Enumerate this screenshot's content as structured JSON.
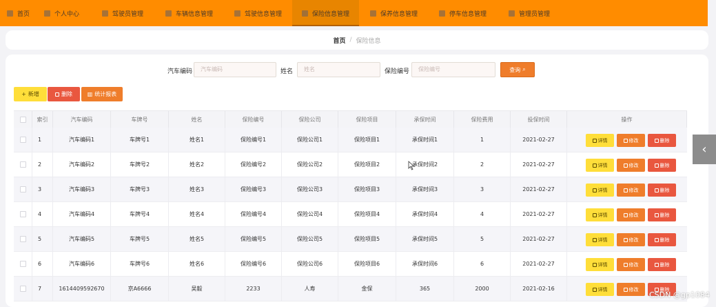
{
  "nav": {
    "items": [
      {
        "label": "首页",
        "icon": "home-icon"
      },
      {
        "label": "个人中心",
        "icon": "user-icon"
      },
      {
        "label": "驾驶员管理",
        "icon": "grid-icon"
      },
      {
        "label": "车辆信息管理",
        "icon": "user-icon"
      },
      {
        "label": "驾驶信息管理",
        "icon": "grid-icon"
      },
      {
        "label": "保险信息管理",
        "icon": "grid-icon"
      },
      {
        "label": "保养信息管理",
        "icon": "grid-icon"
      },
      {
        "label": "停车信息管理",
        "icon": "grid-icon"
      },
      {
        "label": "管理员管理",
        "icon": "user-icon"
      }
    ],
    "active_index": 5,
    "bg_color": "#ff8c00"
  },
  "breadcrumb": {
    "home": "首页",
    "separator": "/",
    "current": "保险信息"
  },
  "search": {
    "fields": [
      {
        "label": "汽车编码",
        "placeholder": "汽车编码"
      },
      {
        "label": "姓名",
        "placeholder": "姓名"
      },
      {
        "label": "保险编号",
        "placeholder": "保险编号"
      }
    ],
    "button_label": "查询"
  },
  "actions": {
    "add": "新增",
    "delete": "删除",
    "stats": "统计报表"
  },
  "table": {
    "headers": [
      "索引",
      "汽车编码",
      "车牌号",
      "姓名",
      "保险编号",
      "保险公司",
      "保险项目",
      "承保时间",
      "保险费用",
      "投保时间",
      "操作"
    ],
    "row_actions": {
      "detail": "详情",
      "edit": "修改",
      "delete": "删除"
    },
    "rows": [
      [
        "1",
        "汽车编码1",
        "车牌号1",
        "姓名1",
        "保险编号1",
        "保险公司1",
        "保险项目1",
        "承保时间1",
        "1",
        "2021-02-27"
      ],
      [
        "2",
        "汽车编码2",
        "车牌号2",
        "姓名2",
        "保险编号2",
        "保险公司2",
        "保险项目2",
        "承保时间2",
        "2",
        "2021-02-27"
      ],
      [
        "3",
        "汽车编码3",
        "车牌号3",
        "姓名3",
        "保险编号3",
        "保险公司3",
        "保险项目3",
        "承保时间3",
        "3",
        "2021-02-27"
      ],
      [
        "4",
        "汽车编码4",
        "车牌号4",
        "姓名4",
        "保险编号4",
        "保险公司4",
        "保险项目4",
        "承保时间4",
        "4",
        "2021-02-27"
      ],
      [
        "5",
        "汽车编码5",
        "车牌号5",
        "姓名5",
        "保险编号5",
        "保险公司5",
        "保险项目5",
        "承保时间5",
        "5",
        "2021-02-27"
      ],
      [
        "6",
        "汽车编码6",
        "车牌号6",
        "姓名6",
        "保险编号6",
        "保险公司6",
        "保险项目6",
        "承保时间6",
        "6",
        "2021-02-27"
      ],
      [
        "7",
        "1614409592670",
        "京A6666",
        "吴毅",
        "2233",
        "人寿",
        "金保",
        "365",
        "2000",
        "2021-02-16"
      ]
    ]
  },
  "side_tab": {
    "icon": "chevron-left-icon",
    "glyph": "‹"
  },
  "watermark": "CSDN @gp1084",
  "colors": {
    "accent": "#ef7d2b",
    "yellow": "#ffde3a",
    "red": "#e9573f"
  }
}
